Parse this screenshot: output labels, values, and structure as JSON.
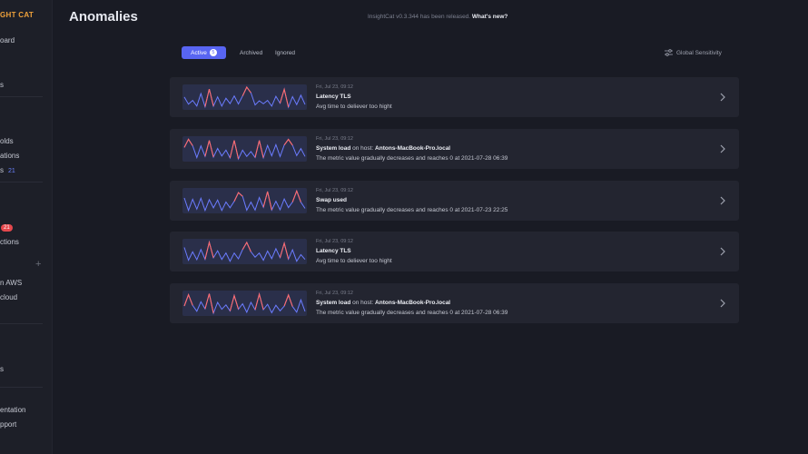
{
  "sidebar": {
    "brand": "GHT CAT",
    "items": [
      "oard",
      "s",
      "olds",
      "ations",
      "s",
      "ctions",
      "n AWS",
      "cloud",
      "s",
      "entation",
      "pport"
    ],
    "count": "21",
    "badge": "21"
  },
  "page": {
    "title": "Anomalies",
    "release_text": "InsightCat v0.3.344 has been released.",
    "release_link": "What's new?"
  },
  "tabs": {
    "active_label": "Active",
    "active_count": "5",
    "archived": "Archived",
    "ignored": "Ignored"
  },
  "sensitivity": {
    "label": "Global Sensitivity",
    "icon": "sliders-icon"
  },
  "colors": {
    "accent": "#5865f2",
    "spark_line": "#6b7cff",
    "spark_peak": "#ff6b6b",
    "brand": "#f0a23b"
  },
  "anomalies": [
    {
      "time": "Fri, Jul 23, 09:12",
      "title": "Latency TLS",
      "host_label": "",
      "host": "",
      "desc": "Avg time to deliever too hight"
    },
    {
      "time": "Fri, Jul 23, 09:12",
      "title": "System load",
      "host_label": " on host: ",
      "host": "Antons-MacBook-Pro.local",
      "desc": "The metric value gradually decreases and reaches 0 at 2021-07-28 06:39"
    },
    {
      "time": "Fri, Jul 23, 09:12",
      "title": "Swap used",
      "host_label": "",
      "host": "",
      "desc": "The metric value gradually decreases and reaches 0 at 2021-07-23 22:25"
    },
    {
      "time": "Fri, Jul 23, 09:12",
      "title": "Latency TLS",
      "host_label": "",
      "host": "",
      "desc": "Avg time to deliever too hight"
    },
    {
      "time": "Fri, Jul 23, 09:12",
      "title": "System load",
      "host_label": " on host: ",
      "host": "Antons-MacBook-Pro.local",
      "desc": "The metric value gradually decreases and reaches 0 at 2021-07-28 06:39"
    }
  ]
}
